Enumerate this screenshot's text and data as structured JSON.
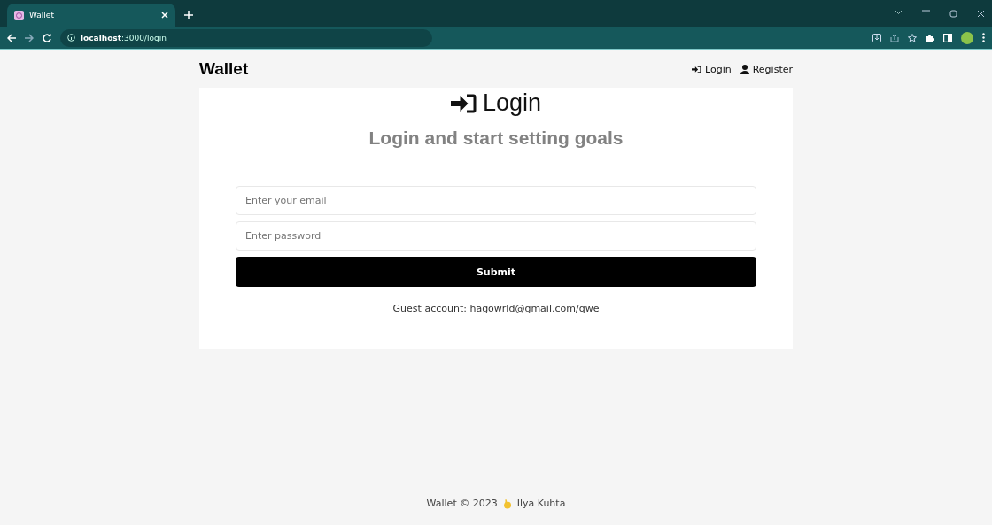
{
  "browser": {
    "tab": {
      "title": "Wallet",
      "selected": true
    },
    "url": {
      "host": "localhost",
      "path": ":3000/login"
    }
  },
  "header": {
    "brand": "Wallet",
    "links": [
      {
        "kind": "login",
        "label": "Login"
      },
      {
        "kind": "register",
        "label": "Register"
      }
    ]
  },
  "card": {
    "title": "Login",
    "subtitle": "Login and start setting goals",
    "fields": [
      {
        "placeholder": "Enter your email"
      },
      {
        "placeholder": "Enter password"
      }
    ],
    "submit": "Submit",
    "note": "Guest account: hagowrld@gmail.com/qwe"
  },
  "footer": {
    "text": "Wallet © 2023",
    "author": "Ilya Kuhta"
  }
}
